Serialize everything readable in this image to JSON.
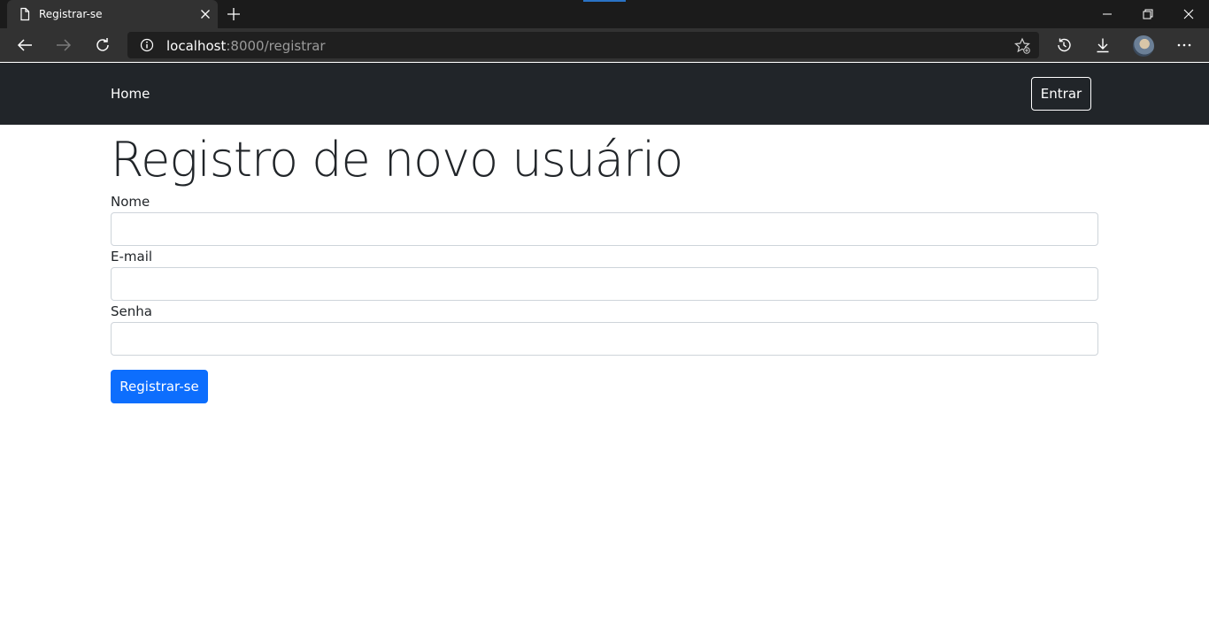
{
  "browser": {
    "tab_title": "Registrar-se",
    "url_host": "localhost",
    "url_rest": ":8000/registrar",
    "icons": [
      "page-icon",
      "close-icon",
      "plus-icon",
      "minimize-icon",
      "restore-icon",
      "close-window-icon",
      "back-arrow-icon",
      "forward-arrow-icon",
      "reload-icon",
      "info-icon",
      "favorite-star-icon",
      "history-icon",
      "download-icon",
      "profile-avatar",
      "more-options-icon"
    ]
  },
  "navbar": {
    "home_label": "Home",
    "login_label": "Entrar"
  },
  "form": {
    "title": "Registro de novo usuário",
    "name_label": "Nome",
    "name_value": "",
    "email_label": "E-mail",
    "email_value": "",
    "password_label": "Senha",
    "password_value": "",
    "submit_label": "Registrar-se"
  },
  "colors": {
    "navbar_bg": "#212529",
    "primary": "#0d6efd",
    "chrome_bg": "#323232"
  }
}
